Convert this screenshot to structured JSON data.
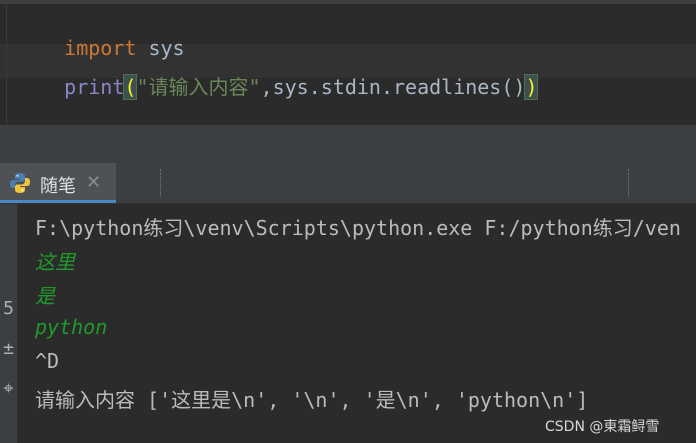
{
  "editor": {
    "line1": {
      "keyword": "import",
      "module": "sys"
    },
    "line2": {
      "func": "print",
      "open_paren": "(",
      "string": "\"请输入内容\"",
      "rest": ",sys.stdin.readlines()",
      "close_paren": ")"
    }
  },
  "tab": {
    "label": "随笔",
    "close": "✕",
    "icon": "python-icon"
  },
  "console": {
    "command": "F:\\python练习\\venv\\Scripts\\python.exe F:/python练习/ven",
    "input_lines": [
      "这里",
      "是",
      "python"
    ],
    "eof": "^D",
    "output": "请输入内容 ['这里是\\n', '\\n', '是\\n', 'python\\n']",
    "gutter_glyphs": [
      "5",
      "±",
      "⌖"
    ]
  },
  "watermark": "CSDN @東霜鲟雪",
  "colors": {
    "background": "#2b2b2b",
    "keyword": "#cc7832",
    "string": "#6a8759",
    "input_green": "#1f9a2a"
  }
}
